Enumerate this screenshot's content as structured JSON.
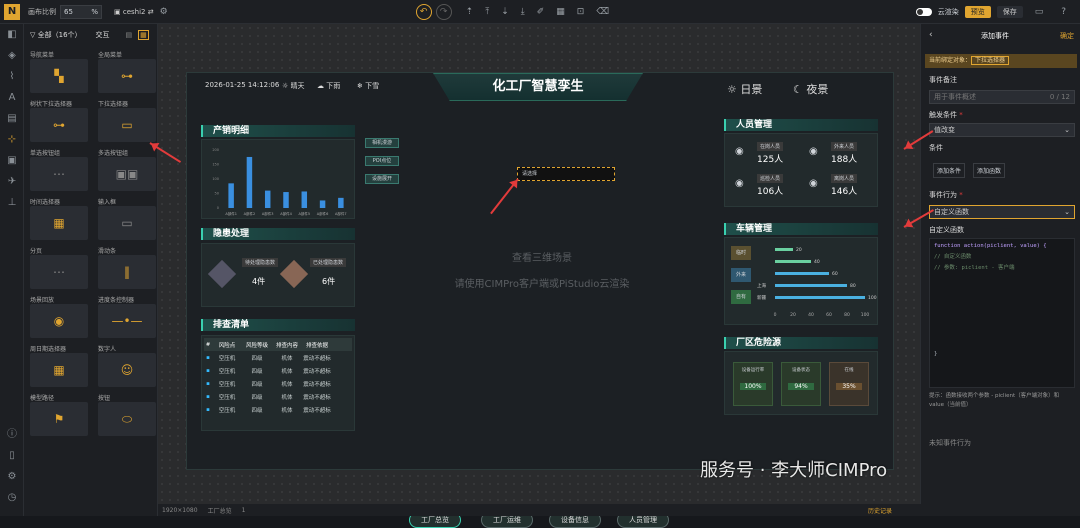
{
  "topbar": {
    "canvas_ratio_label": "画布比例",
    "zoom_value": "65",
    "zoom_unit": "%",
    "project_name": "ceshi2",
    "cloud_label": "云渲染",
    "publish_label": "预览",
    "save_label": "保存"
  },
  "component_panel": {
    "filter_label": "全部（16个）",
    "interaction_tab": "交互",
    "items": [
      {
        "label": "导航菜单"
      },
      {
        "label": "全局菜单"
      },
      {
        "label": "树状下拉选择器"
      },
      {
        "label": "下拉选择器"
      },
      {
        "label": "单选按钮组"
      },
      {
        "label": "多选按钮组"
      },
      {
        "label": "时间选择器"
      },
      {
        "label": "输入框"
      },
      {
        "label": "分页"
      },
      {
        "label": "滑动条"
      },
      {
        "label": "场景回放"
      },
      {
        "label": "进度条控制器"
      },
      {
        "label": "周日期选择器"
      },
      {
        "label": "数字人"
      },
      {
        "label": "模型路径"
      },
      {
        "label": "按钮"
      }
    ]
  },
  "screen": {
    "datetime": "2026-01-25 14:12:06",
    "weather": [
      "晴天",
      "下雨",
      "下雪"
    ],
    "title": "化工厂智慧孪生",
    "day_label": "日景",
    "night_label": "夜景",
    "center_hint_1": "查看三维场景",
    "center_hint_2": "请使用CIMPro客户端或PiStudio云渲染",
    "selected_widget": "请选择",
    "small_buttons": [
      "相机漫游",
      "POI点位",
      "设施展开"
    ],
    "prod_title": "产销明细",
    "prod_chart": {
      "categories": [
        "A部件1",
        "A部件2",
        "A部件3",
        "A部件4",
        "A部件5",
        "A部件6",
        "A部件7"
      ],
      "values": [
        85,
        176,
        60,
        55,
        57,
        26,
        35
      ],
      "ylim": [
        0,
        200
      ]
    },
    "hazard_title": "隐患处理",
    "hazard": [
      {
        "label": "待处理隐患数",
        "value": "4件"
      },
      {
        "label": "已处理隐患数",
        "value": "6件"
      }
    ],
    "check_title": "排查清单",
    "check_headers": [
      "#",
      "风险点",
      "风险等级",
      "排查内容",
      "排查依据"
    ],
    "check_rows": [
      [
        "空压机",
        "四级",
        "机体",
        "震动不超标"
      ],
      [
        "空压机",
        "四级",
        "机体",
        "震动不超标"
      ],
      [
        "空压机",
        "四级",
        "机体",
        "震动不超标"
      ],
      [
        "空压机",
        "四级",
        "机体",
        "震动不超标"
      ],
      [
        "空压机",
        "四级",
        "机体",
        "震动不超标"
      ]
    ],
    "staff_title": "人员管理",
    "staff": [
      {
        "label": "在岗人员",
        "value": "125人"
      },
      {
        "label": "外来人员",
        "value": "188人"
      },
      {
        "label": "巡检人员",
        "value": "106人"
      },
      {
        "label": "离岗人员",
        "value": "146人"
      }
    ],
    "vehicle_title": "车辆管理",
    "vehicle_tags": [
      "临时",
      "外来",
      "自有"
    ],
    "vehicle_bars": [
      {
        "label": "",
        "value": 20
      },
      {
        "label": "",
        "value": 40
      },
      {
        "label": "",
        "value": 60
      },
      {
        "label": "上海",
        "value": 80
      },
      {
        "label": "新疆",
        "value": 100
      }
    ],
    "vehicle_axis": [
      "0",
      "20",
      "40",
      "60",
      "80",
      "100"
    ],
    "risk_title": "厂区危险源",
    "risks": [
      {
        "label": "设备运行率",
        "value": "100%"
      },
      {
        "label": "设备状态",
        "value": "94%"
      },
      {
        "label": "在线",
        "value": "35%"
      }
    ],
    "bottom_tabs": [
      "工厂总览",
      "工厂运维",
      "设备信息",
      "人员管理"
    ]
  },
  "right_panel": {
    "title": "添加事件",
    "confirm": "确定",
    "bound_object_label": "当前绑定对象：",
    "bound_object_value": "下拉选择器",
    "event_note_label": "事件备注",
    "event_note_placeholder": "用于事件概述",
    "event_note_count": "0 / 12",
    "trigger_label": "触发条件",
    "trigger_value": "值改变",
    "condition_label": "条件",
    "add_condition": "添加条件",
    "add_function": "添加函数",
    "action_label": "事件行为",
    "action_value": "自定义函数",
    "custom_fn_label": "自定义函数",
    "code_lines": [
      "function  action(piclient, value)  {",
      "    // 自定义函数",
      "    // 参数: piclient - 客户端",
      "}"
    ],
    "hint": "提示：函数接收两个参数 - piclient（客户端对象）和 value（当前值）",
    "unknown_action": "未知事件行为"
  },
  "bottombar": {
    "size": "1920×1080",
    "layer": "工厂总览",
    "count": "1",
    "history": "历史记录"
  },
  "watermark": "服务号 · 李大师CIMPro"
}
